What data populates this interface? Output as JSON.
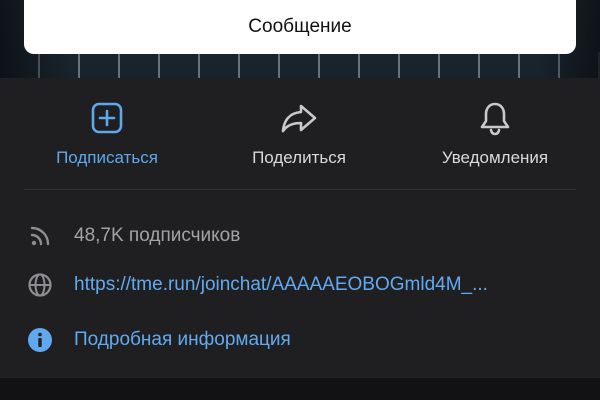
{
  "header": {
    "message_button": "Сообщение"
  },
  "actions": [
    {
      "label": "Подписаться",
      "icon": "add-square-icon",
      "color": "#5fa8ee"
    },
    {
      "label": "Поделиться",
      "icon": "share-arrow-icon"
    },
    {
      "label": "Уведомления",
      "icon": "bell-icon"
    }
  ],
  "info": {
    "subscribers": "48,7K подписчиков",
    "link": "https://tme.run/joinchat/AAAAAEOBOGmld4M_...",
    "details": "Подробная информация"
  },
  "colors": {
    "accent": "#5fa8ee",
    "background": "#1f1f21",
    "text_secondary": "#a3a3a6"
  }
}
